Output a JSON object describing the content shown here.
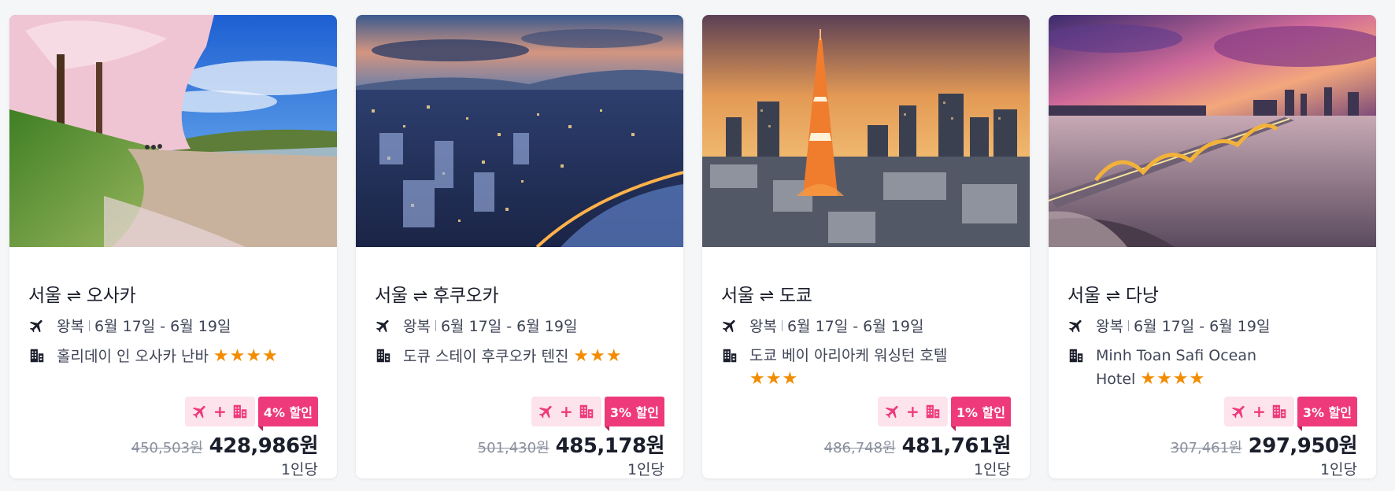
{
  "cards": [
    {
      "route_from": "서울",
      "route_arrow": "⇌",
      "route_to": "오사카",
      "trip_type": "왕복",
      "dates": "6월 17일 - 6월 19일",
      "hotel": "홀리데이 인 오사카 난바",
      "stars": "★★★★",
      "pkg_plus": "+",
      "discount": "4% 할인",
      "old_price": "450,503원",
      "price": "428,986원",
      "per": "1인당"
    },
    {
      "route_from": "서울",
      "route_arrow": "⇌",
      "route_to": "후쿠오카",
      "trip_type": "왕복",
      "dates": "6월 17일 - 6월 19일",
      "hotel": "도큐 스테이 후쿠오카 텐진",
      "stars": "★★★",
      "pkg_plus": "+",
      "discount": "3% 할인",
      "old_price": "501,430원",
      "price": "485,178원",
      "per": "1인당"
    },
    {
      "route_from": "서울",
      "route_arrow": "⇌",
      "route_to": "도쿄",
      "trip_type": "왕복",
      "dates": "6월 17일 - 6월 19일",
      "hotel": "도쿄 베이 아리아케 워싱턴 호텔",
      "stars": "★★★",
      "pkg_plus": "+",
      "discount": "1% 할인",
      "old_price": "486,748원",
      "price": "481,761원",
      "per": "1인당"
    },
    {
      "route_from": "서울",
      "route_arrow": "⇌",
      "route_to": "다낭",
      "trip_type": "왕복",
      "dates": "6월 17일 - 6월 19일",
      "hotel": "Minh Toan Safi Ocean Hotel",
      "stars": "★★★★",
      "pkg_plus": "+",
      "discount": "3% 할인",
      "old_price": "307,461원",
      "price": "297,950원",
      "per": "1인당"
    }
  ],
  "icons": {
    "plane": "airplane-icon",
    "hotel": "building-icon"
  },
  "colors": {
    "accent_pink": "#ee3a7a",
    "pkg_bg": "#fde3ec",
    "star": "#f28c00"
  }
}
